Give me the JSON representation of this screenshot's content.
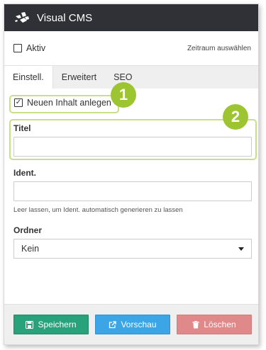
{
  "app": {
    "title": "Visual CMS"
  },
  "toolbar": {
    "active_label": "Aktiv",
    "timerange_label": "Zeitraum auswählen"
  },
  "tabs": [
    {
      "label": "Einstell."
    },
    {
      "label": "Erweitert"
    },
    {
      "label": "SEO"
    }
  ],
  "form": {
    "new_content_label": "Neuen Inhalt anlegen",
    "title_label": "Titel",
    "title_value": "",
    "ident_label": "Ident.",
    "ident_value": "",
    "ident_hint": "Leer lassen, um Ident. automatisch generieren zu lassen",
    "folder_label": "Ordner",
    "folder_value": "Kein"
  },
  "callouts": {
    "one": "1",
    "two": "2"
  },
  "buttons": {
    "save": "Speichern",
    "preview": "Vorschau",
    "delete": "Löschen"
  },
  "colors": {
    "header_bg": "#2f3136",
    "save": "#27a27a",
    "preview": "#3ba5e6",
    "delete": "#e0898a",
    "callout": "#9cc531"
  }
}
